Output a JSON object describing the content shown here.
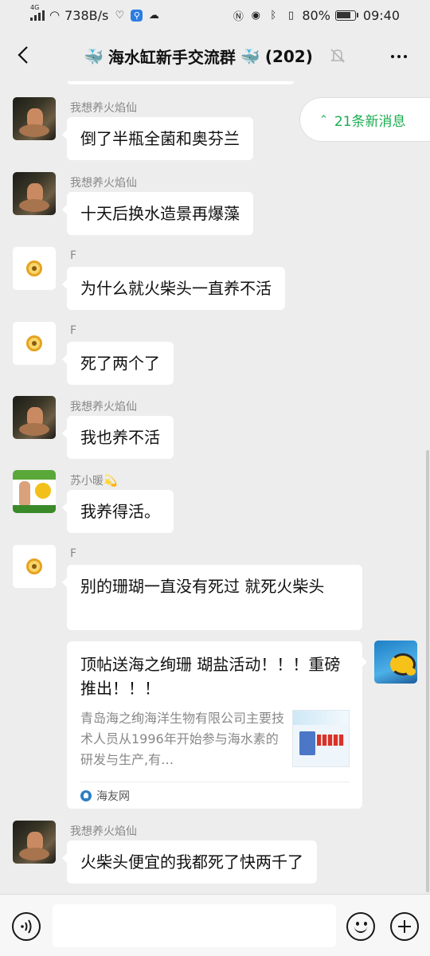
{
  "status_bar": {
    "network_type": "4G",
    "speed": "738B/s",
    "battery_percent": "80%",
    "battery_level": 0.8,
    "time": "09:40",
    "icons": [
      "signal-icon",
      "wifi-icon",
      "health-icon",
      "app-notification-icon",
      "cloud-icon",
      "nfc-icon",
      "eye-icon",
      "bluetooth-icon",
      "vibrate-icon",
      "battery-icon"
    ]
  },
  "header": {
    "title": "海水缸新手交流群",
    "member_count": "(202)",
    "title_emoji": "🐳",
    "icons": [
      "back-icon",
      "mute-bell-icon",
      "more-icon"
    ]
  },
  "new_messages": {
    "label": "21条新消息"
  },
  "messages": [
    {
      "sender": "我想养火焰仙",
      "text": "倒了半瓶全菌和奥芬兰",
      "avatar": "dark-photo"
    },
    {
      "sender": "我想养火焰仙",
      "text": "十天后换水造景再爆藻",
      "avatar": "dark-photo"
    },
    {
      "sender": "F",
      "text": "为什么就火柴头一直养不活",
      "avatar": "yellow-ring"
    },
    {
      "sender": "F",
      "text": "死了两个了",
      "avatar": "yellow-ring"
    },
    {
      "sender": "我想养火焰仙",
      "text": "我也养不活",
      "avatar": "dark-photo"
    },
    {
      "sender": "苏小暖",
      "sender_emoji": "💫",
      "text": "我养得活。",
      "avatar": "promo"
    },
    {
      "sender": "F",
      "text": "别的珊瑚一直没有死过 就死火柴头",
      "avatar": "yellow-ring"
    },
    {
      "sender": "我想养火焰仙",
      "text": "火柴头便宜的我都死了快两千了",
      "avatar": "dark-photo"
    }
  ],
  "link_card": {
    "title": "顶帖送海之绚珊 瑚盐活动！！！重磅推出！！！",
    "description": "青岛海之绚海洋生物有限公司主要技术人员从1996年开始参与海水素的研发与生产,有…",
    "source": "海友网",
    "sender_avatar": "fish-photo"
  },
  "input_bar": {
    "placeholder": "",
    "icons": [
      "voice-icon",
      "emoji-icon",
      "plus-icon"
    ]
  }
}
